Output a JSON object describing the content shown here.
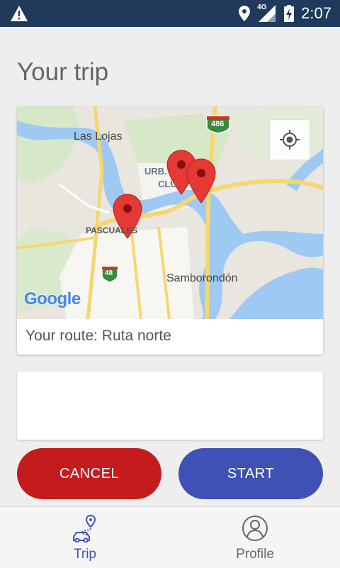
{
  "status_bar": {
    "time": "2:07",
    "network": "4G"
  },
  "page": {
    "title": "Your trip"
  },
  "map": {
    "place_labels": {
      "las_lojas": "Las Lojas",
      "urb": "URB.",
      "clu": "CLU",
      "pascuales": "PASCUALES",
      "samborondon": "Samborondón",
      "highway_486": "486",
      "highway_48": "48",
      "google": "Google"
    },
    "route_text": "Your route: Ruta norte"
  },
  "actions": {
    "cancel_label": "CANCEL",
    "start_label": "START"
  },
  "bottom_nav": {
    "items": [
      {
        "label": "Trip",
        "icon": "trip-route-icon",
        "active": true
      },
      {
        "label": "Profile",
        "icon": "profile-icon",
        "active": false
      }
    ]
  },
  "colors": {
    "status_bar": "#1f3a5a",
    "cancel": "#c41c1c",
    "start": "#3f51b5",
    "active_nav": "#3f51b5",
    "marker": "#e53935"
  }
}
